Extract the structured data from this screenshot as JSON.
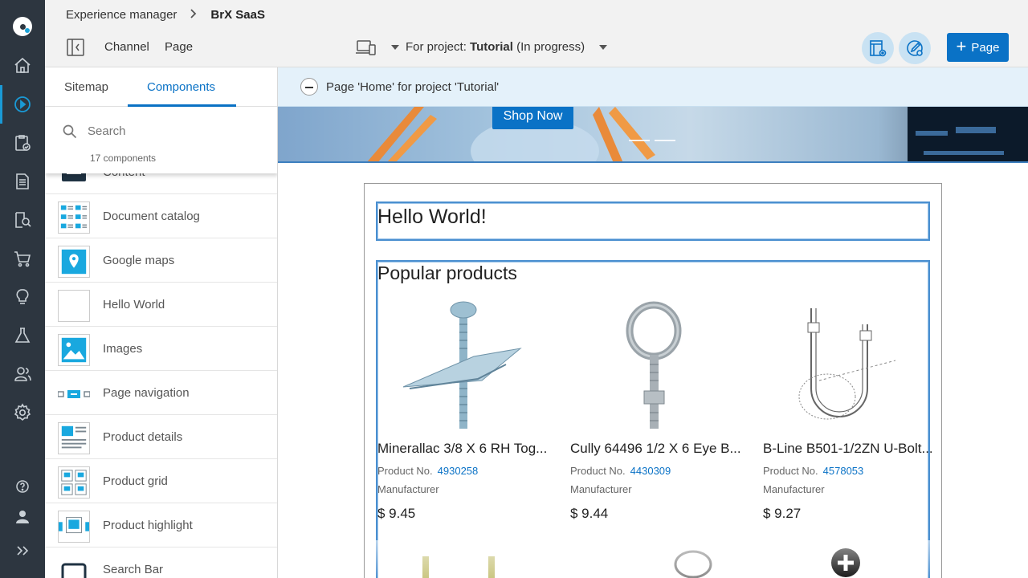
{
  "breadcrumb": {
    "root": "Experience manager",
    "current": "BrX SaaS"
  },
  "toolbar": {
    "channel_label": "Channel",
    "page_label": "Page",
    "project_prefix": "For project:",
    "project_name": "Tutorial",
    "project_status": "(In progress)",
    "add_page_label": "Page"
  },
  "panel": {
    "tabs": [
      {
        "label": "Sitemap"
      },
      {
        "label": "Components"
      }
    ],
    "active_tab": "Components",
    "search_placeholder": "Search",
    "count_label": "17 components",
    "components": [
      {
        "label": "Content"
      },
      {
        "label": "Document catalog"
      },
      {
        "label": "Google maps"
      },
      {
        "label": "Hello World"
      },
      {
        "label": "Images"
      },
      {
        "label": "Page navigation"
      },
      {
        "label": "Product details"
      },
      {
        "label": "Product grid"
      },
      {
        "label": "Product highlight"
      },
      {
        "label": "Search Bar"
      }
    ]
  },
  "infobar": {
    "text": "Page 'Home' for project 'Tutorial'"
  },
  "preview": {
    "banner_button": "Shop Now",
    "hello_title": "Hello World!",
    "popular_title": "Popular products",
    "products": [
      {
        "name": "Minerallac 3/8 X 6 RH Tog...",
        "no_label": "Product No.",
        "no": "4930258",
        "manufacturer": "Manufacturer",
        "price": "$ 9.45"
      },
      {
        "name": "Cully 64496 1/2 X 6 Eye B...",
        "no_label": "Product No.",
        "no": "4430309",
        "manufacturer": "Manufacturer",
        "price": "$ 9.44"
      },
      {
        "name": "B-Line B501-1/2ZN U-Bolt...",
        "no_label": "Product No.",
        "no": "4578053",
        "manufacturer": "Manufacturer",
        "price": "$ 9.27"
      }
    ]
  },
  "colors": {
    "accent": "#0a72c6",
    "rail": "#2d3640",
    "infobar": "#e4f1fa",
    "highlight": "#1a9ad6"
  }
}
